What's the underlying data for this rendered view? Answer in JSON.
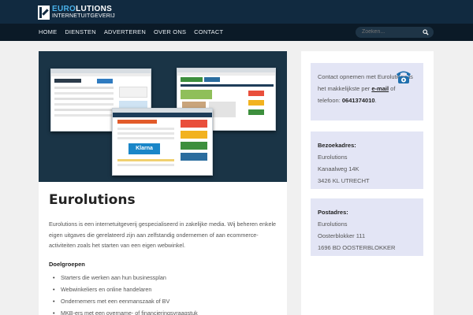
{
  "brand": {
    "name_highlight": "EURO",
    "name_rest": "LUTIONS",
    "subtitle": "INTERNETUITGEVERIJ"
  },
  "nav": {
    "items": [
      {
        "label": "HOME"
      },
      {
        "label": "DIENSTEN"
      },
      {
        "label": "ADVERTEREN"
      },
      {
        "label": "OVER ONS"
      },
      {
        "label": "CONTACT"
      }
    ]
  },
  "search": {
    "placeholder": "Zoeken..."
  },
  "main": {
    "hero_label": "Klarna",
    "title": "Eurolutions",
    "intro": "Eurolutions is een internetuitgeverij gespecialiseerd in zakelijke media. Wij beheren enkele eigen uitgaves die gerelateerd zijn aan zelfstandig ondernemen of aan ecommerce-activiteiten zoals het starten van een eigen webwinkel.",
    "section_heading": "Doelgroepen",
    "bullets": [
      "Starters die werken aan hun businessplan",
      "Webwinkeliers en online handelaren",
      "Ondernemers met een eenmanszaak of BV",
      "MKB-ers met een overname- of financieringsvraagstuk"
    ]
  },
  "sidebar": {
    "contact": {
      "text_before": "Contact opnemen met Eurolutions is het makkelijkste per ",
      "email_label": "e-mail",
      "text_middle": " of telefoon: ",
      "phone": "0641374010",
      "text_end": "."
    },
    "visit": {
      "title": "Bezoekadres:",
      "line1": "Eurolutions",
      "line2": "Kanaalweg 14K",
      "line3": "3426 KL UTRECHT"
    },
    "post": {
      "title": "Postadres:",
      "line1": "Eurolutions",
      "line2": "Oosterblokker 111",
      "line3": "1696 BD OOSTERBLOKKER"
    }
  },
  "colors": {
    "header": "#112a40",
    "nav": "#0b1a27",
    "accent": "#4ab0e8",
    "sidebar_box": "#e3e5f5",
    "hero_bg": "#1a3446"
  },
  "icons": [
    "logo-mark",
    "search-icon",
    "phone-icon"
  ]
}
